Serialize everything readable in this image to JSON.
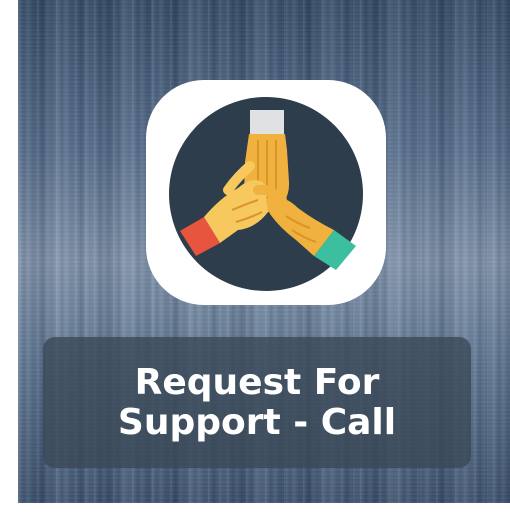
{
  "app": {
    "label": "Request For Support - Call",
    "icon": "hands-together-icon"
  },
  "colors": {
    "icon_background": "#ffffff",
    "icon_circle": "#2e3d4c",
    "hand_skin": "#f0b13e",
    "hand_skin_light": "#f7c85e",
    "sleeve_top": "#dfe1e3",
    "sleeve_left": "#e8553f",
    "sleeve_right": "#3bbf9f"
  }
}
